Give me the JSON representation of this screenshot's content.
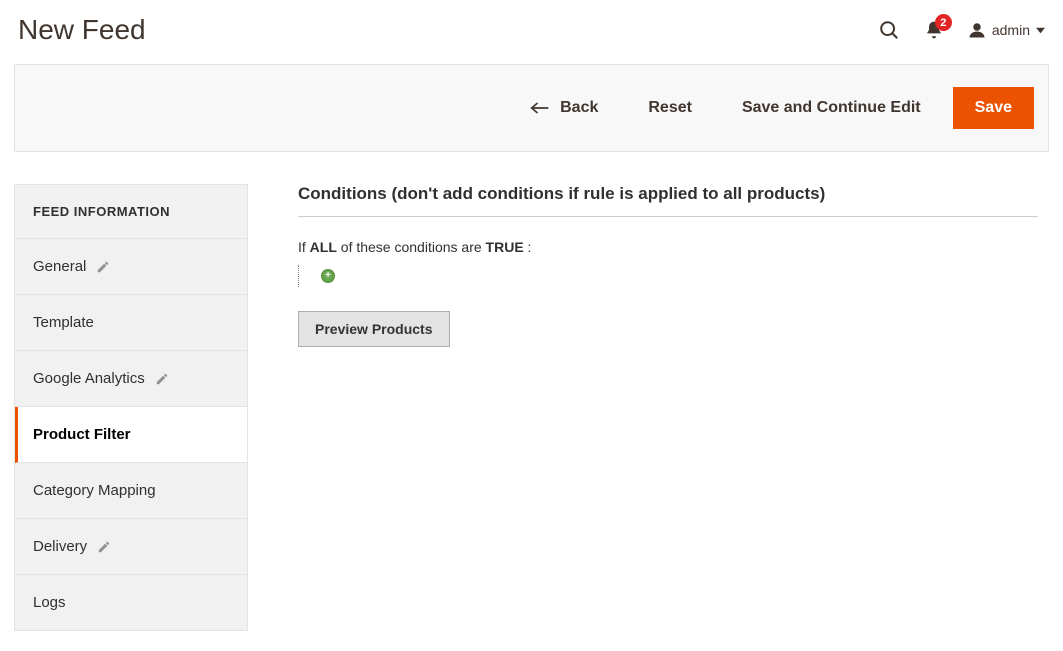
{
  "header": {
    "title": "New Feed",
    "notifications_count": "2",
    "user_label": "admin"
  },
  "actions": {
    "back": "Back",
    "reset": "Reset",
    "save_continue": "Save and Continue Edit",
    "save": "Save"
  },
  "sidebar": {
    "title": "FEED INFORMATION",
    "items": [
      {
        "label": "General",
        "has_edit": true,
        "active": false
      },
      {
        "label": "Template",
        "has_edit": false,
        "active": false
      },
      {
        "label": "Google Analytics",
        "has_edit": true,
        "active": false
      },
      {
        "label": "Product Filter",
        "has_edit": false,
        "active": true
      },
      {
        "label": "Category Mapping",
        "has_edit": false,
        "active": false
      },
      {
        "label": "Delivery",
        "has_edit": true,
        "active": false
      },
      {
        "label": "Logs",
        "has_edit": false,
        "active": false
      }
    ]
  },
  "main": {
    "section_title": "Conditions (don't add conditions if rule is applied to all products)",
    "condition_prefix": "If ",
    "condition_aggregator": "ALL",
    "condition_middle": " of these conditions are ",
    "condition_value": "TRUE",
    "condition_suffix": " :",
    "preview_button": "Preview Products"
  },
  "colors": {
    "primary": "#eb5202",
    "badge": "#e22626"
  }
}
